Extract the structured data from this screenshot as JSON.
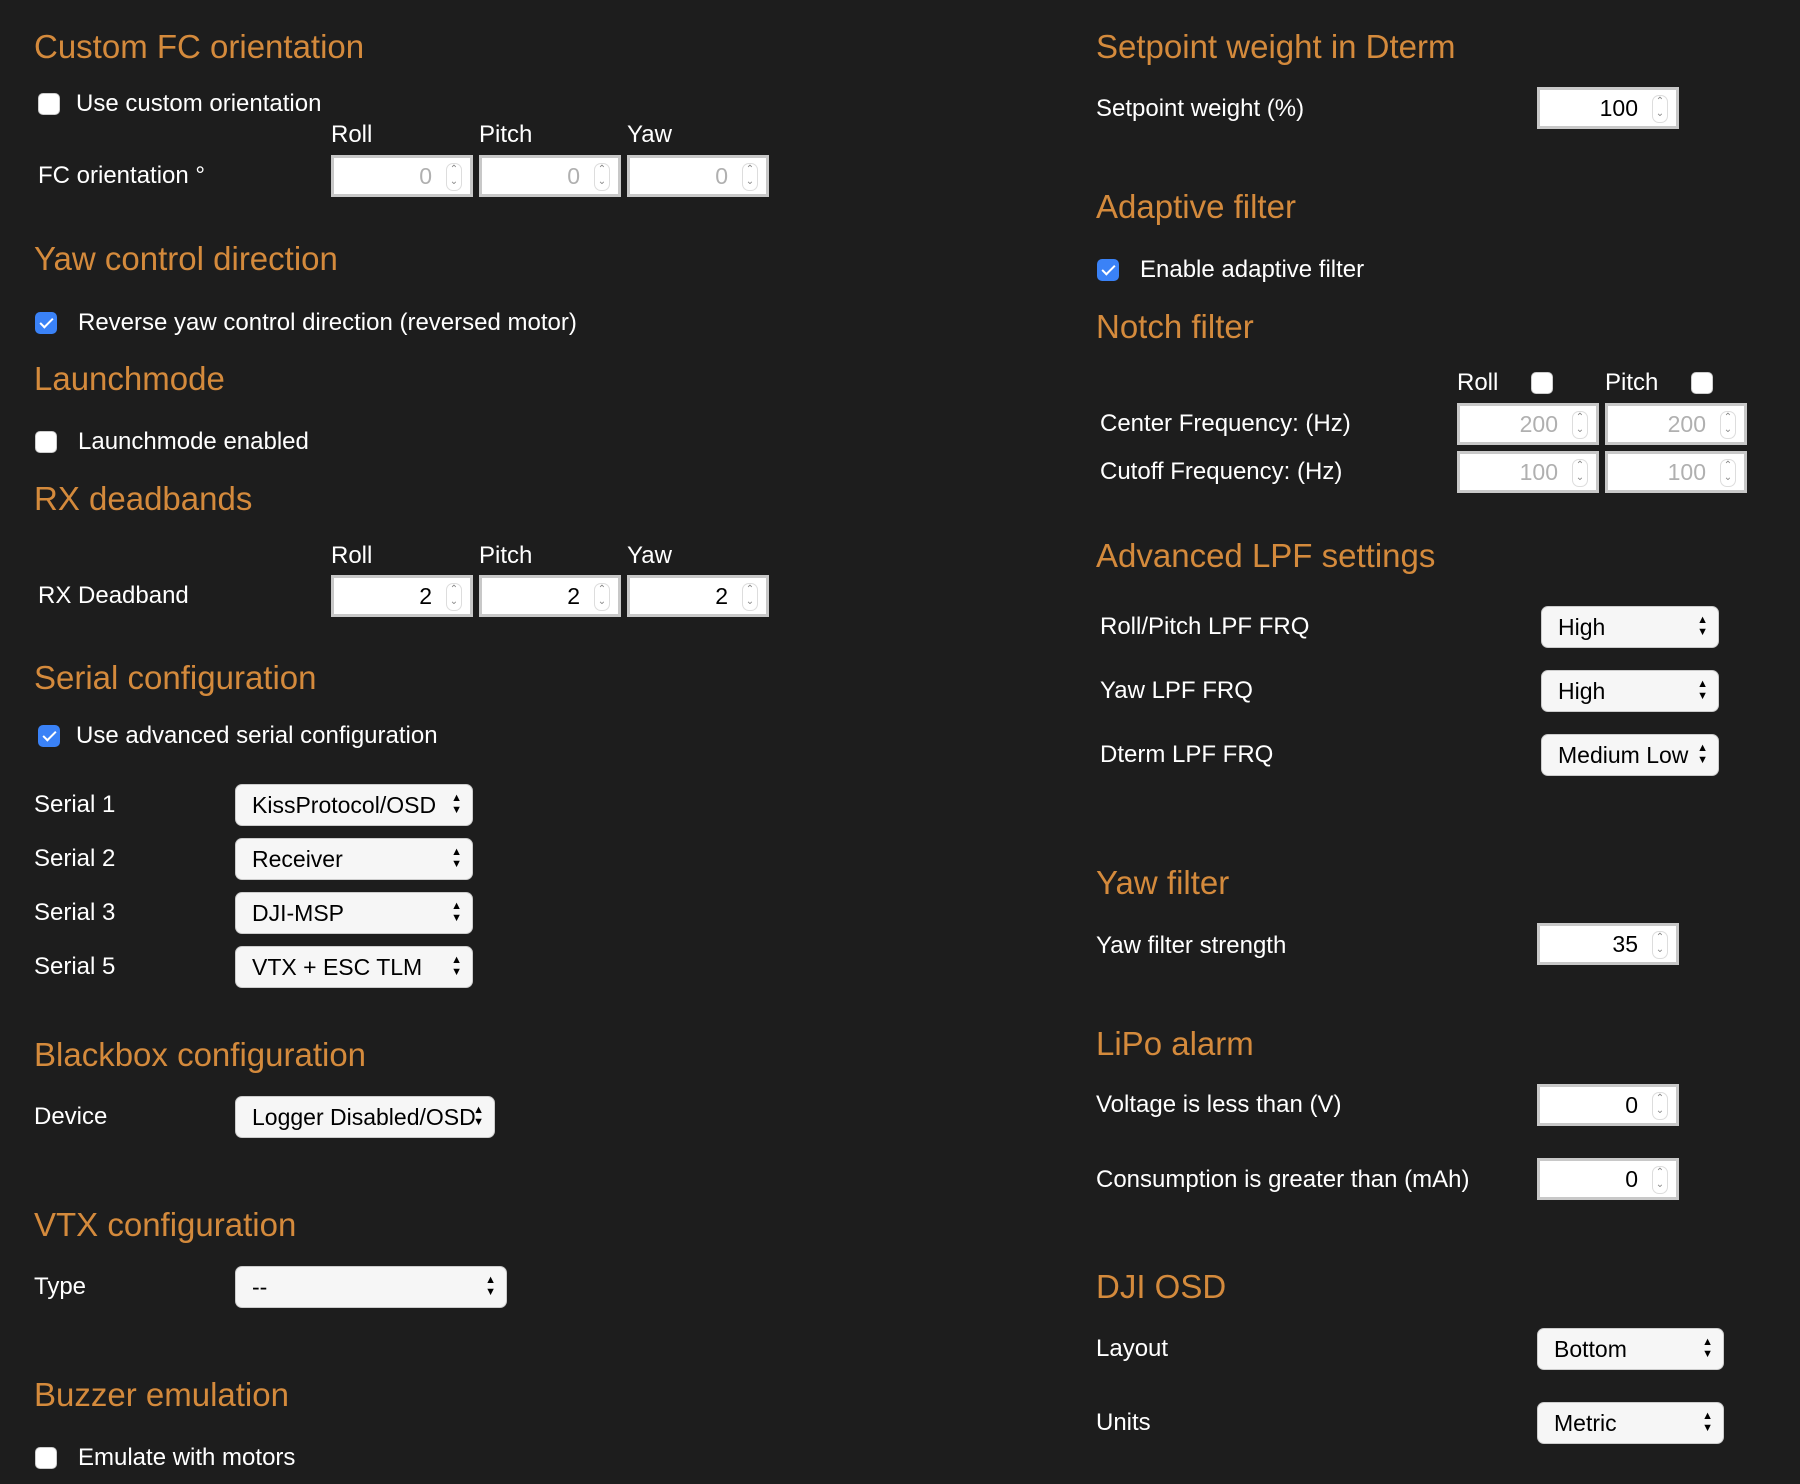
{
  "colors": {
    "heading": "#d48a3c",
    "background": "#1d1d1d",
    "checkbox_checked": "#3a82f7"
  },
  "left": {
    "fc": {
      "title": "Custom FC orientation",
      "checkbox_label": "Use custom orientation",
      "checked": false,
      "cols": [
        "Roll",
        "Pitch",
        "Yaw"
      ],
      "row_label": "FC orientation °",
      "values": [
        "0",
        "0",
        "0"
      ],
      "disabled": true
    },
    "yaw": {
      "title": "Yaw control direction",
      "checkbox_label": "Reverse yaw control direction (reversed motor)",
      "checked": true
    },
    "launch": {
      "title": "Launchmode",
      "checkbox_label": "Launchmode enabled",
      "checked": false
    },
    "rx": {
      "title": "RX deadbands",
      "cols": [
        "Roll",
        "Pitch",
        "Yaw"
      ],
      "row_label": "RX Deadband",
      "values": [
        "2",
        "2",
        "2"
      ]
    },
    "serial": {
      "title": "Serial configuration",
      "checkbox_label": "Use advanced serial configuration",
      "checked": true,
      "rows": [
        {
          "label": "Serial 1",
          "value": "KissProtocol/OSD"
        },
        {
          "label": "Serial 2",
          "value": "Receiver"
        },
        {
          "label": "Serial 3",
          "value": "DJI-MSP"
        },
        {
          "label": "Serial 5",
          "value": "VTX + ESC TLM"
        }
      ]
    },
    "blackbox": {
      "title": "Blackbox configuration",
      "label": "Device",
      "value": "Logger Disabled/OSD"
    },
    "vtx": {
      "title": "VTX configuration",
      "label": "Type",
      "value": "--"
    },
    "buzzer": {
      "title": "Buzzer emulation",
      "checkbox_label": "Emulate with motors",
      "checked": false
    }
  },
  "right": {
    "setpoint": {
      "title": "Setpoint weight in Dterm",
      "label": "Setpoint weight (%)",
      "value": "100"
    },
    "adaptive": {
      "title": "Adaptive filter",
      "checkbox_label": "Enable adaptive filter",
      "checked": true
    },
    "notch": {
      "title": "Notch filter",
      "cols": [
        "Roll",
        "Pitch"
      ],
      "roll_enabled": false,
      "pitch_enabled": false,
      "center_label": "Center Frequency: (Hz)",
      "center_values": [
        "200",
        "200"
      ],
      "cutoff_label": "Cutoff Frequency: (Hz)",
      "cutoff_values": [
        "100",
        "100"
      ]
    },
    "lpf": {
      "title": "Advanced LPF settings",
      "rows": [
        {
          "label": "Roll/Pitch LPF FRQ",
          "value": "High"
        },
        {
          "label": "Yaw LPF FRQ",
          "value": "High"
        },
        {
          "label": "Dterm LPF FRQ",
          "value": "Medium Low"
        }
      ]
    },
    "yawfilter": {
      "title": "Yaw filter",
      "label": "Yaw filter strength",
      "value": "35"
    },
    "lipo": {
      "title": "LiPo alarm",
      "voltage_label": "Voltage is less than (V)",
      "voltage_value": "0",
      "consumption_label": "Consumption is greater than (mAh)",
      "consumption_value": "0"
    },
    "dji": {
      "title": "DJI OSD",
      "layout_label": "Layout",
      "layout_value": "Bottom",
      "units_label": "Units",
      "units_value": "Metric"
    }
  },
  "icons": {
    "spinner": "number-spinner-icon",
    "select": "select-arrows-icon"
  }
}
